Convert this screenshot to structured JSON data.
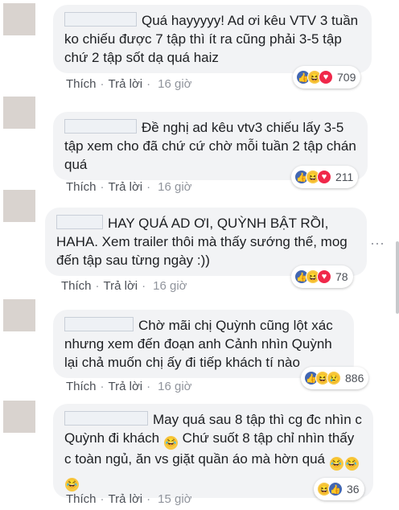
{
  "comments": [
    {
      "text": "Quá hayyyyy! Ad ơi kêu VTV 3 tuần ko chiếu được 7 tập thì ít ra cũng phải 3-5 tập chứ 2 tập sốt dạ quá haiz",
      "like": "Thích",
      "reply": "Trả lời",
      "time": "16 giờ",
      "reactions": [
        "like-icon",
        "haha-icon",
        "love-icon"
      ],
      "count": "709"
    },
    {
      "text": "Đề nghị ad kêu vtv3 chiếu lấy 3-5 tập xem cho đã chứ cứ chờ mỗi tuần 2 tập chán quá",
      "like": "Thích",
      "reply": "Trả lời",
      "time": "16 giờ",
      "reactions": [
        "like-icon",
        "haha-icon",
        "love-icon"
      ],
      "count": "211"
    },
    {
      "text": "HAY QUÁ AD ƠI, QUỲNH BẬT RỒI, HAHA. Xem trailer thôi mà thấy sướng thế, mog đến tập sau từng ngày :))",
      "like": "Thích",
      "reply": "Trả lời",
      "time": "16 giờ",
      "reactions": [
        "like-icon",
        "haha-icon",
        "love-icon"
      ],
      "count": "78"
    },
    {
      "text": "Chờ mãi chị Quỳnh cũng lột xác nhưng xem đến đoạn anh Cảnh nhìn Quỳnh lại chả muốn chị ấy đi tiếp khách tí nào",
      "like": "Thích",
      "reply": "Trả lời",
      "time": "16 giờ",
      "reactions": [
        "like-icon",
        "haha-icon",
        "sad-icon"
      ],
      "count": "886"
    },
    {
      "text_a": "May quá sau 8 tập thì cg đc nhìn c Quỳnh đi khách",
      "text_b": "Chứ suốt 8 tập chỉ nhìn thấy c toàn ngủ, ăn vs giặt quần áo mà hờn quá",
      "like": "Thích",
      "reply": "Trả lời",
      "time": "15 giờ",
      "reactions": [
        "haha-icon",
        "like-icon"
      ],
      "count": "36"
    }
  ],
  "more_label": "···"
}
